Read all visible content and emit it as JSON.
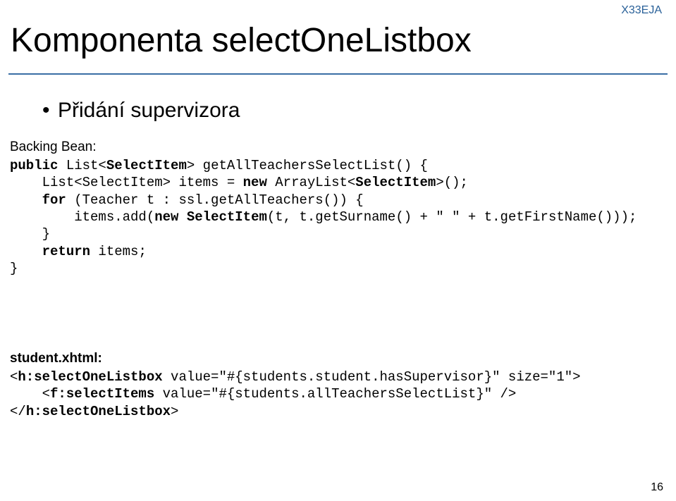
{
  "course_tag": "X33EJA",
  "title": "Komponenta selectOneListbox",
  "bullet": "Přidání supervizora",
  "section1_label": "Backing Bean:",
  "code1_l1a": "public",
  "code1_l1b": " List<",
  "code1_l1c": "SelectItem",
  "code1_l1d": "> getAllTeachersSelectList() {",
  "code1_l2a": "    List<SelectItem> items = ",
  "code1_l2b": "new",
  "code1_l2c": " ArrayList<",
  "code1_l2d": "SelectItem",
  "code1_l2e": ">();",
  "code1_l3a": "    ",
  "code1_l3b": "for",
  "code1_l3c": " (Teacher t : ssl.getAllTeachers()) {",
  "code1_l4a": "        items.add(",
  "code1_l4b": "new",
  "code1_l4c": " ",
  "code1_l4d": "SelectItem",
  "code1_l4e": "(t, t.getSurname() + \" \" + t.getFirstName()));",
  "code1_l5": "    }",
  "code1_l6a": "    ",
  "code1_l6b": "return",
  "code1_l6c": " items;",
  "code1_l7": "}",
  "section2_label": "student.xhtml:",
  "code2_l1a": "<",
  "code2_l1b": "h:selectOneListbox",
  "code2_l1c": " value=\"#{students.student.hasSupervisor}\" size=\"1\">",
  "code2_l2a": "    <",
  "code2_l2b": "f:selectItems",
  "code2_l2c": " value=\"#{students.allTeachersSelectList}\" />",
  "code2_l3a": "</",
  "code2_l3b": "h:selectOneListbox",
  "code2_l3c": ">",
  "page_number": "16"
}
